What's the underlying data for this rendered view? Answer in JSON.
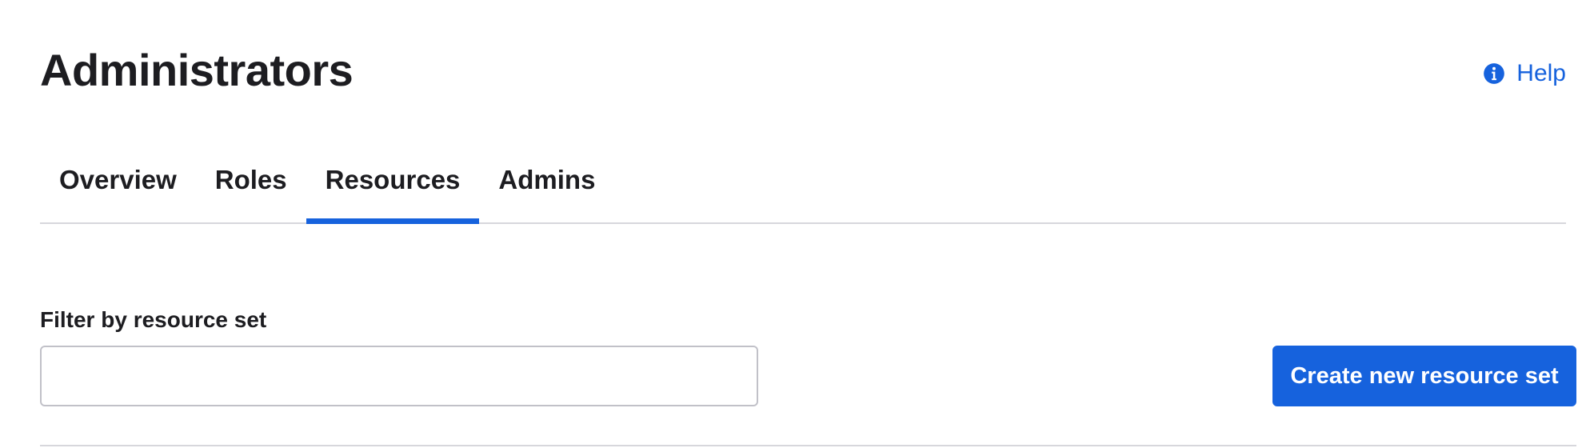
{
  "header": {
    "title": "Administrators",
    "help_label": "Help",
    "help_icon": "info-circle-icon"
  },
  "tabs": [
    {
      "label": "Overview",
      "active": false
    },
    {
      "label": "Roles",
      "active": false
    },
    {
      "label": "Resources",
      "active": true
    },
    {
      "label": "Admins",
      "active": false
    }
  ],
  "filter": {
    "label": "Filter by resource set",
    "value": "",
    "placeholder": ""
  },
  "actions": {
    "create_label": "Create new resource set"
  },
  "colors": {
    "accent": "#1662dd",
    "text": "#1d1d21",
    "border": "#c1c1c8",
    "divider": "#d7d7dc"
  }
}
